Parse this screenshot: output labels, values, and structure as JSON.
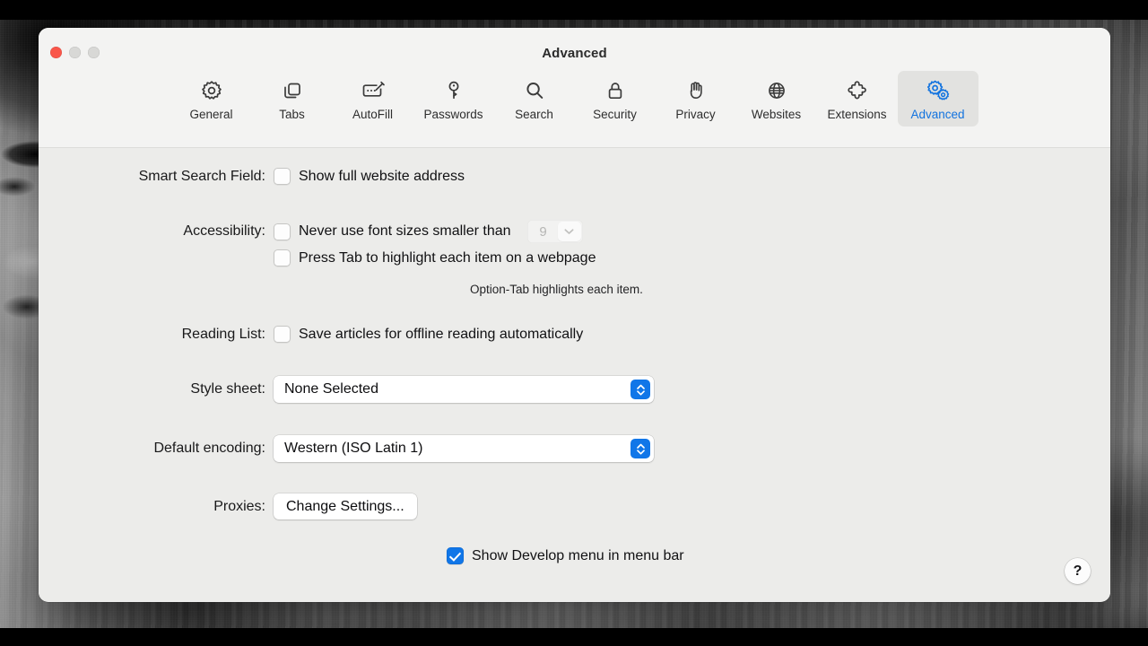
{
  "window": {
    "title": "Advanced",
    "traffic_lights": [
      {
        "name": "close",
        "color": "#f9564a"
      },
      {
        "name": "minimize",
        "color": "#d8d8d6"
      },
      {
        "name": "zoom",
        "color": "#d8d8d6"
      }
    ]
  },
  "accent_color": "#1076e8",
  "tabs": [
    {
      "label": "General",
      "icon": "gear-icon",
      "selected": false
    },
    {
      "label": "Tabs",
      "icon": "tabs-icon",
      "selected": false
    },
    {
      "label": "AutoFill",
      "icon": "autofill-icon",
      "selected": false
    },
    {
      "label": "Passwords",
      "icon": "key-icon",
      "selected": false
    },
    {
      "label": "Search",
      "icon": "search-icon",
      "selected": false
    },
    {
      "label": "Security",
      "icon": "lock-icon",
      "selected": false
    },
    {
      "label": "Privacy",
      "icon": "hand-icon",
      "selected": false
    },
    {
      "label": "Websites",
      "icon": "globe-icon",
      "selected": false
    },
    {
      "label": "Extensions",
      "icon": "puzzle-icon",
      "selected": false
    },
    {
      "label": "Advanced",
      "icon": "gears-icon",
      "selected": true
    }
  ],
  "settings": {
    "smart_search_field": {
      "label": "Smart Search Field:",
      "checkbox_label": "Show full website address",
      "checked": false
    },
    "accessibility": {
      "label": "Accessibility:",
      "min_font_checkbox_label": "Never use font sizes smaller than",
      "min_font_checked": false,
      "min_font_value": "9",
      "min_font_disabled": true,
      "tab_highlight_checkbox_label": "Press Tab to highlight each item on a webpage",
      "tab_highlight_checked": false,
      "hint": "Option-Tab highlights each item."
    },
    "reading_list": {
      "label": "Reading List:",
      "checkbox_label": "Save articles for offline reading automatically",
      "checked": false
    },
    "style_sheet": {
      "label": "Style sheet:",
      "value": "None Selected"
    },
    "default_encoding": {
      "label": "Default encoding:",
      "value": "Western (ISO Latin 1)"
    },
    "proxies": {
      "label": "Proxies:",
      "button_label": "Change Settings..."
    },
    "develop_menu": {
      "checkbox_label": "Show Develop menu in menu bar",
      "checked": true
    }
  },
  "help_button": {
    "glyph": "?"
  }
}
